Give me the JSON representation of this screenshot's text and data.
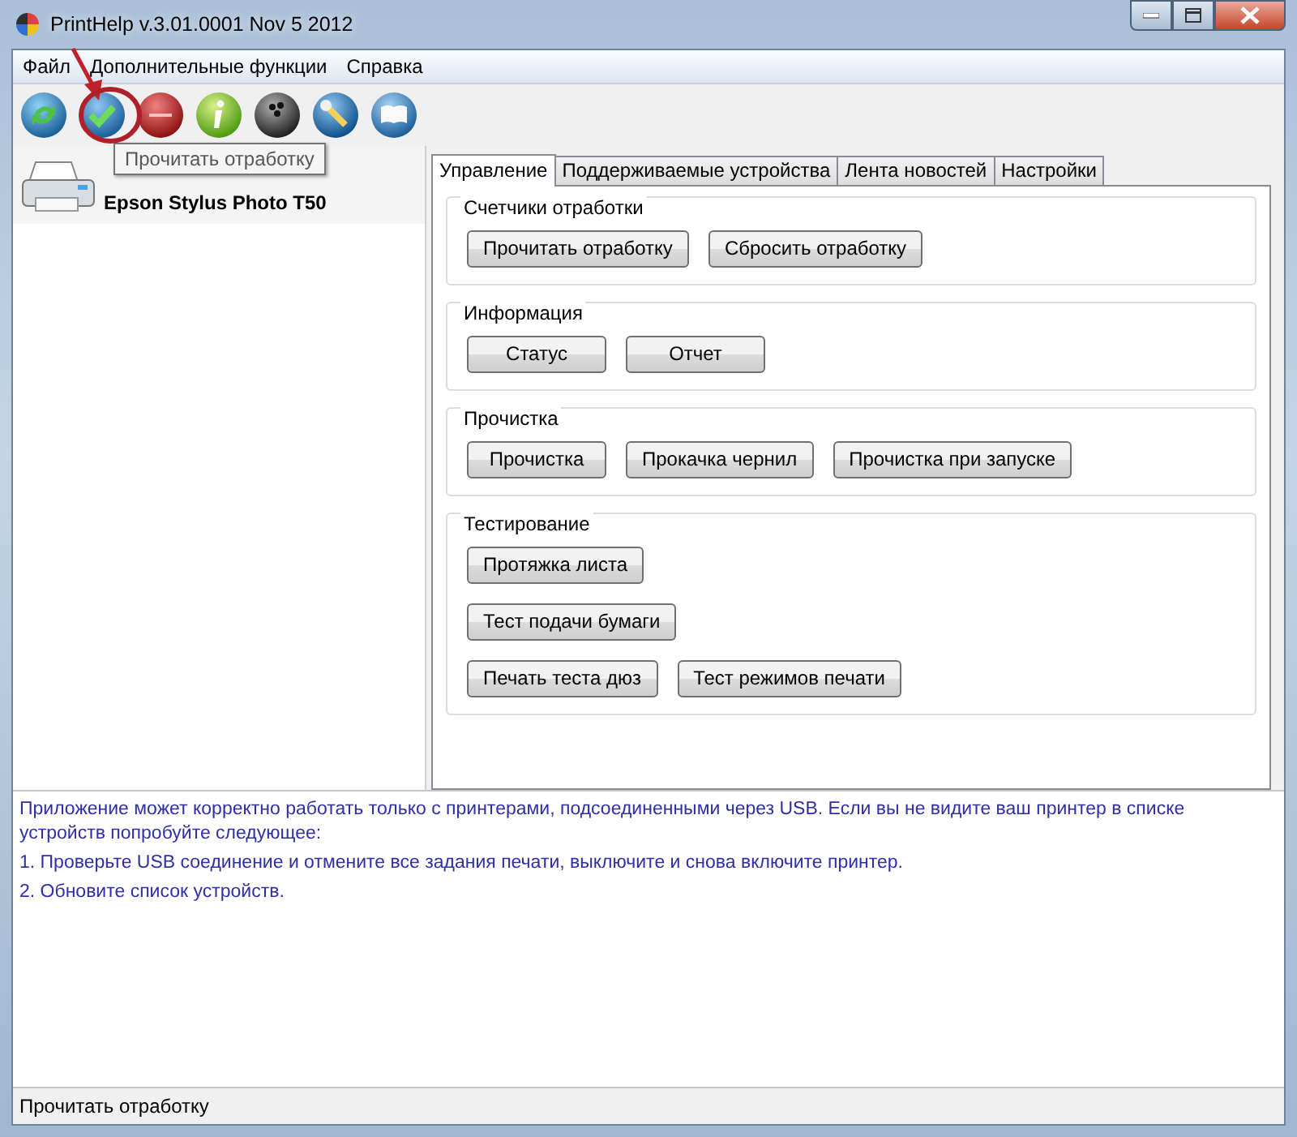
{
  "window": {
    "title": "PrintHelp v.3.01.0001 Nov  5 2012"
  },
  "menu": [
    "Файл",
    "Дополнительные функции",
    "Справка"
  ],
  "toolbar": [
    {
      "kind": "recycle"
    },
    {
      "kind": "check"
    },
    {
      "kind": "reset"
    },
    {
      "kind": "info"
    },
    {
      "kind": "ball"
    },
    {
      "kind": "wrench"
    },
    {
      "kind": "book"
    }
  ],
  "tooltip": "Прочитать отработку",
  "devices": [
    {
      "name": "Epson Stylus Photo T50",
      "selected": false
    }
  ],
  "tabs": [
    {
      "label": "Управление",
      "selected": true
    },
    {
      "label": "Поддерживаемые устройства",
      "selected": false
    },
    {
      "label": "Лента новостей",
      "selected": false
    },
    {
      "label": "Настройки",
      "selected": false
    }
  ],
  "groups": [
    {
      "title": "Счетчики отработки",
      "rows": [
        [
          "Прочитать отработку",
          "Сбросить отработку"
        ]
      ]
    },
    {
      "title": "Информация",
      "rows": [
        [
          "Статус",
          "Отчет"
        ]
      ]
    },
    {
      "title": "Прочистка",
      "rows": [
        [
          "Прочистка",
          "Прокачка чернил",
          "Прочистка при запуске"
        ]
      ]
    },
    {
      "title": "Тестирование",
      "rows": [
        [
          "Протяжка листа"
        ],
        [
          "Тест подачи бумаги"
        ],
        [
          "Печать теста дюз",
          "Тест режимов печати"
        ]
      ]
    }
  ],
  "info": [
    "Приложение может корректно работать только с принтерами, подсоединенными через USB. Если вы не видите ваш принтер в списке устройств попробуйте следующее:",
    "1. Проверьте USB соединение и отмените все задания печати, выключите и снова включите принтер.",
    "2. Обновите список устройств."
  ],
  "status_bar": "Прочитать отработку"
}
